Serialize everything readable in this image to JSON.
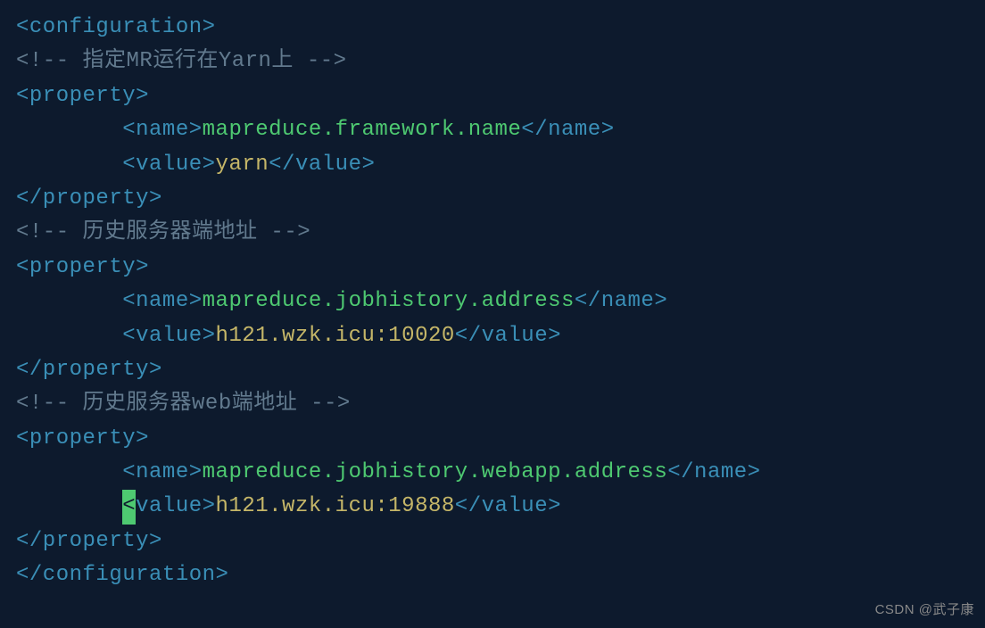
{
  "lines": {
    "l1": {
      "tag_open": "<configuration>"
    },
    "l2": {
      "comment": "<!-- 指定MR运行在Yarn上 -->"
    },
    "l3": {
      "tag_open": "<property>"
    },
    "l4": {
      "indent": "        ",
      "name_open": "<name>",
      "name_val": "mapreduce.framework.name",
      "name_close": "</name>"
    },
    "l5": {
      "indent": "        ",
      "value_open": "<value>",
      "value_val": "yarn",
      "value_close": "</value>"
    },
    "l6": {
      "tag_close": "</property>"
    },
    "l7": {
      "comment": "<!-- 历史服务器端地址 -->"
    },
    "l8": {
      "tag_open": "<property>"
    },
    "l9": {
      "indent": "        ",
      "name_open": "<name>",
      "name_val": "mapreduce.jobhistory.address",
      "name_close": "</name>"
    },
    "l10": {
      "indent": "        ",
      "value_open": "<value>",
      "value_val": "h121.wzk.icu:10020",
      "value_close": "</value>"
    },
    "l11": {
      "tag_close": "</property>"
    },
    "l12": {
      "comment": "<!-- 历史服务器web端地址 -->"
    },
    "l13": {
      "tag_open": "<property>"
    },
    "l14": {
      "indent": "        ",
      "name_open": "<name>",
      "name_val": "mapreduce.jobhistory.webapp.address",
      "name_close": "</name>"
    },
    "l15": {
      "indent": "        ",
      "cursor": "<",
      "value_open_rest": "value>",
      "value_val": "h121.wzk.icu:19888",
      "value_close": "</value>"
    },
    "l16": {
      "tag_close": "</property>"
    },
    "l17": {
      "tag_close": "</configuration>"
    }
  },
  "watermark": "CSDN @武子康"
}
